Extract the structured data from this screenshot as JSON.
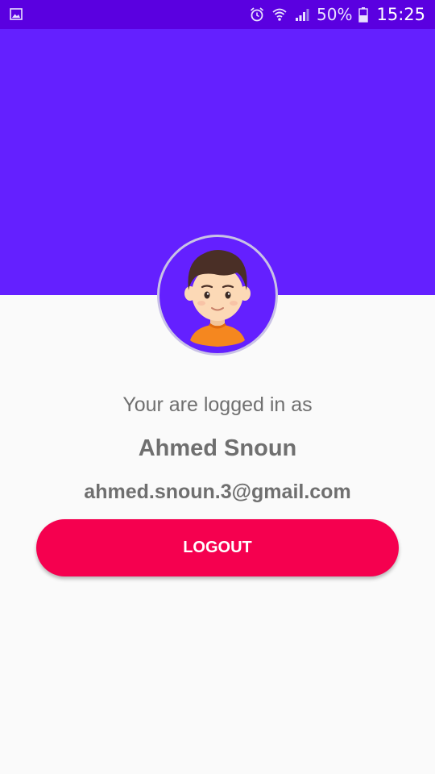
{
  "status_bar": {
    "battery_percent": "50%",
    "time": "15:25",
    "icons": [
      "gallery-notification-icon",
      "alarm-icon",
      "wifi-icon",
      "signal-icon",
      "battery-icon"
    ]
  },
  "profile": {
    "logged_in_label": "Your are logged in as",
    "name": "Ahmed Snoun",
    "email": "ahmed.snoun.3@gmail.com",
    "avatar": "male-avatar"
  },
  "actions": {
    "logout_label": "LOGOUT"
  },
  "colors": {
    "status_bar": "#5a00e0",
    "header": "#6420ff",
    "background": "#fafafa",
    "logout_button": "#f5004f",
    "text": "#6f6f6f"
  }
}
